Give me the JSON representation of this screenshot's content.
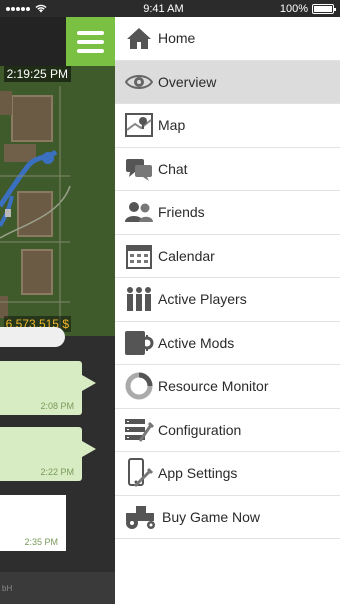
{
  "status_bar": {
    "time": "9:41 AM",
    "battery": "100%",
    "battery_level": 1.0
  },
  "map": {
    "time": "2:19:25 PM",
    "money": "6,573,515 $"
  },
  "chat": {
    "messages": [
      {
        "time": "2:08 PM",
        "style": "incoming"
      },
      {
        "time": "2:22 PM",
        "style": "incoming"
      },
      {
        "time": "2:35 PM",
        "style": "outgoing"
      }
    ]
  },
  "footer": {
    "text": "bH"
  },
  "menu": {
    "items": [
      {
        "label": "Home",
        "icon": "home-icon"
      },
      {
        "label": "Overview",
        "icon": "eye-icon",
        "active": true
      },
      {
        "label": "Map",
        "icon": "map-icon"
      },
      {
        "label": "Chat",
        "icon": "chat-icon"
      },
      {
        "label": "Friends",
        "icon": "friends-icon"
      },
      {
        "label": "Calendar",
        "icon": "calendar-icon"
      },
      {
        "label": "Active Players",
        "icon": "players-icon"
      },
      {
        "label": "Active Mods",
        "icon": "mods-icon"
      },
      {
        "label": "Resource Monitor",
        "icon": "resource-monitor-icon"
      },
      {
        "label": "Configuration",
        "icon": "configuration-icon"
      },
      {
        "label": "App Settings",
        "icon": "app-settings-icon"
      },
      {
        "label": "Buy Game Now",
        "icon": "tractor-icon"
      }
    ]
  },
  "colors": {
    "accent": "#7ac042",
    "money": "#f2b52c",
    "bubble": "#d8ecc4"
  }
}
